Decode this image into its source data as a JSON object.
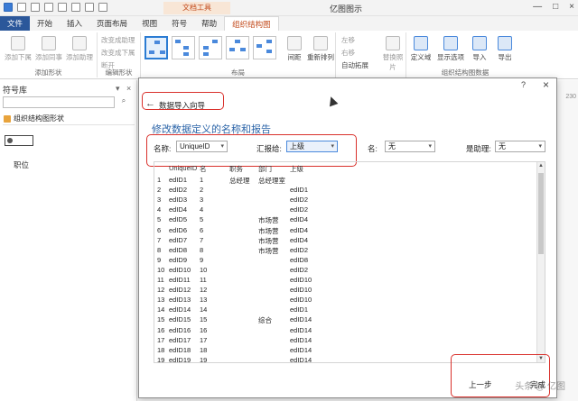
{
  "app": {
    "title": "亿图图示",
    "context_tab": "文档工具"
  },
  "ribbon_tabs": [
    "文件",
    "开始",
    "插入",
    "页面布局",
    "视图",
    "符号",
    "帮助",
    "组织结构图"
  ],
  "ribbon": {
    "add_shape_group": {
      "label": "添加形状",
      "buttons": [
        "添加下属",
        "添加同事",
        "添加助理"
      ]
    },
    "edit_shape_group": {
      "label": "编辑形状",
      "items": [
        "改变成助理",
        "改变成下属",
        "断开"
      ]
    },
    "layout_group": {
      "label": "布局",
      "buttons": [
        "间距",
        "重新排列"
      ]
    },
    "move_group": {
      "items": [
        "左移",
        "右移",
        "自动拓展",
        "替换照片"
      ]
    },
    "data_group": {
      "label": "组织结构图数据",
      "buttons": [
        "定义域",
        "显示选项",
        "导入",
        "导出"
      ]
    }
  },
  "left_panel": {
    "title": "符号库",
    "category": "组织结构图形状",
    "shape_label": "职位"
  },
  "ruler": {
    "mark": "230"
  },
  "dialog": {
    "help": "?",
    "close": "×",
    "wizard_title": "数据导入向导",
    "heading": "修改数据定义的名称和报告",
    "fields": {
      "name_label": "名称:",
      "name_value": "UniqueID",
      "report_label": "汇报给:",
      "report_value": "上级",
      "name2_label": "名:",
      "name2_value": "无",
      "assistant_label": "是助理:",
      "assistant_value": "无"
    },
    "table": {
      "headers": [
        "UniqueID",
        "名",
        "职务",
        "部门",
        "上级"
      ],
      "rows": [
        [
          "1",
          "edID1",
          "1",
          "总经理",
          "总经理室",
          ""
        ],
        [
          "2",
          "edID2",
          "2",
          "",
          "",
          "edID1"
        ],
        [
          "3",
          "edID3",
          "3",
          "",
          "",
          "edID2"
        ],
        [
          "4",
          "edID4",
          "4",
          "",
          "",
          "edID2"
        ],
        [
          "5",
          "edID5",
          "5",
          "",
          "市场营",
          "edID4"
        ],
        [
          "6",
          "edID6",
          "6",
          "",
          "市场营",
          "edID4"
        ],
        [
          "7",
          "edID7",
          "7",
          "",
          "市场营",
          "edID4"
        ],
        [
          "8",
          "edID8",
          "8",
          "",
          "市场营",
          "edID2"
        ],
        [
          "9",
          "edID9",
          "9",
          "",
          "",
          "edID8"
        ],
        [
          "10",
          "edID10",
          "10",
          "",
          "",
          "edID2"
        ],
        [
          "11",
          "edID11",
          "11",
          "",
          "",
          "edID10"
        ],
        [
          "12",
          "edID12",
          "12",
          "",
          "",
          "edID10"
        ],
        [
          "13",
          "edID13",
          "13",
          "",
          "",
          "edID10"
        ],
        [
          "14",
          "edID14",
          "14",
          "",
          "",
          "edID1"
        ],
        [
          "15",
          "edID15",
          "15",
          "",
          "综合",
          "edID14"
        ],
        [
          "16",
          "edID16",
          "16",
          "",
          "",
          "edID14"
        ],
        [
          "17",
          "edID17",
          "17",
          "",
          "",
          "edID14"
        ],
        [
          "18",
          "edID18",
          "18",
          "",
          "",
          "edID14"
        ],
        [
          "19",
          "edID19",
          "19",
          "",
          "",
          "edID14"
        ]
      ]
    },
    "buttons": {
      "back": "上一步",
      "finish": "完成"
    }
  },
  "watermark": "头条 @ 亿图"
}
